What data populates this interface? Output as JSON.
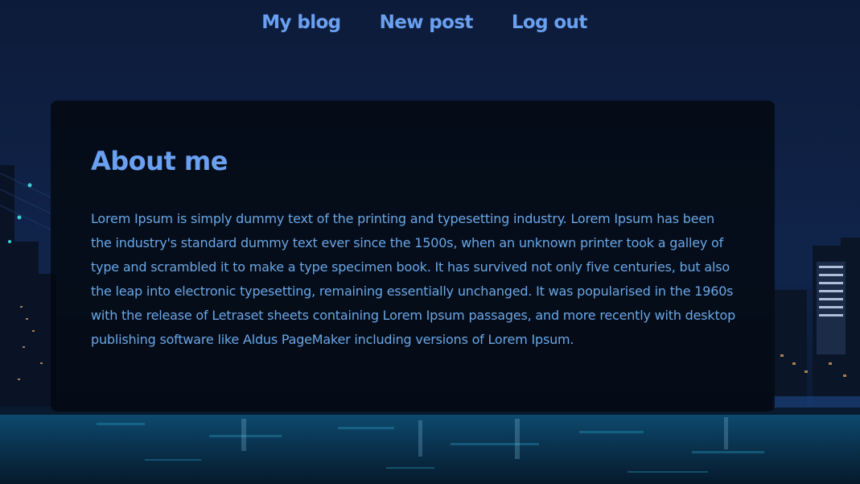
{
  "nav": {
    "items": [
      {
        "label": "My blog"
      },
      {
        "label": "New post"
      },
      {
        "label": "Log out"
      }
    ]
  },
  "about": {
    "heading": "About me",
    "body": "Lorem Ipsum is simply dummy text of the printing and typesetting industry. Lorem Ipsum has been the industry's standard dummy text ever since the 1500s, when an unknown printer took a galley of type and scrambled it to make a type specimen book. It has survived not only five centuries, but also the leap into electronic typesetting, remaining essentially unchanged. It was popularised in the 1960s with the release of Letraset sheets containing Lorem Ipsum passages, and more recently with desktop publishing software like Aldus PageMaker including versions of Lorem Ipsum."
  },
  "colors": {
    "accent": "#6aa0f0",
    "card_background": "#040810",
    "sky": "#0c1a36",
    "water": "#0a3a5a"
  }
}
